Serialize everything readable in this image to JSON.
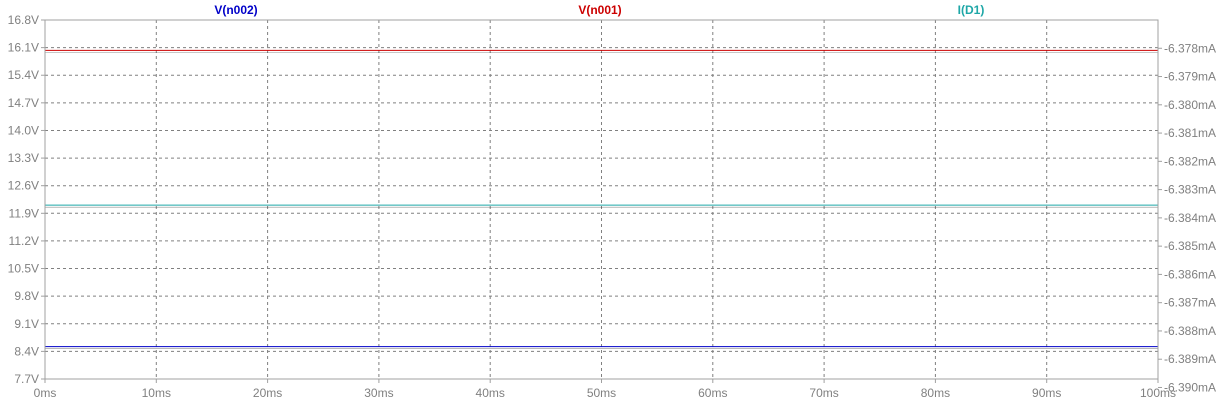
{
  "chart_data": {
    "type": "line",
    "x_ticks": [
      "0ms",
      "10ms",
      "20ms",
      "30ms",
      "40ms",
      "50ms",
      "60ms",
      "70ms",
      "80ms",
      "90ms",
      "100ms"
    ],
    "x_values": [
      0,
      10,
      20,
      30,
      40,
      50,
      60,
      70,
      80,
      90,
      100
    ],
    "xlim": [
      0,
      100
    ],
    "y_left_ticks": [
      "16.8V",
      "16.1V",
      "15.4V",
      "14.7V",
      "14.0V",
      "13.3V",
      "12.6V",
      "11.9V",
      "11.2V",
      "10.5V",
      "9.8V",
      "9.1V",
      "8.4V",
      "7.7V"
    ],
    "y_left_values": [
      16.8,
      16.1,
      15.4,
      14.7,
      14.0,
      13.3,
      12.6,
      11.9,
      11.2,
      10.5,
      9.8,
      9.1,
      8.4,
      7.7
    ],
    "ylim_left": [
      7.7,
      16.8
    ],
    "y_right_ticks": [
      "-6.378mA",
      "-6.379mA",
      "-6.380mA",
      "-6.381mA",
      "-6.382mA",
      "-6.383mA",
      "-6.384mA",
      "-6.385mA",
      "-6.386mA",
      "-6.387mA",
      "-6.388mA",
      "-6.389mA",
      "-6.390mA"
    ],
    "y_right_values": [
      -6.378,
      -6.379,
      -6.38,
      -6.381,
      -6.382,
      -6.383,
      -6.384,
      -6.385,
      -6.386,
      -6.387,
      -6.388,
      -6.389,
      -6.39
    ],
    "ylim_right": [
      -6.3897,
      -6.377
    ],
    "grid": true,
    "series": [
      {
        "name": "V(n002)",
        "color": "#0000c8",
        "axis": "left",
        "x": [
          0,
          100
        ],
        "y": [
          8.52,
          8.52
        ]
      },
      {
        "name": "V(n001)",
        "color": "#cc0000",
        "axis": "left",
        "x": [
          0,
          100
        ],
        "y": [
          16.03,
          16.03
        ]
      },
      {
        "name": "I(D1)",
        "color": "#1ea7a7",
        "axis": "right",
        "x": [
          0,
          100
        ],
        "y": [
          -6.38355,
          -6.38355
        ]
      }
    ]
  },
  "colors": {
    "axis": "#a0a0a0",
    "grid": "#808080",
    "tick_text": "#808080",
    "cursor_line": "#333333"
  }
}
